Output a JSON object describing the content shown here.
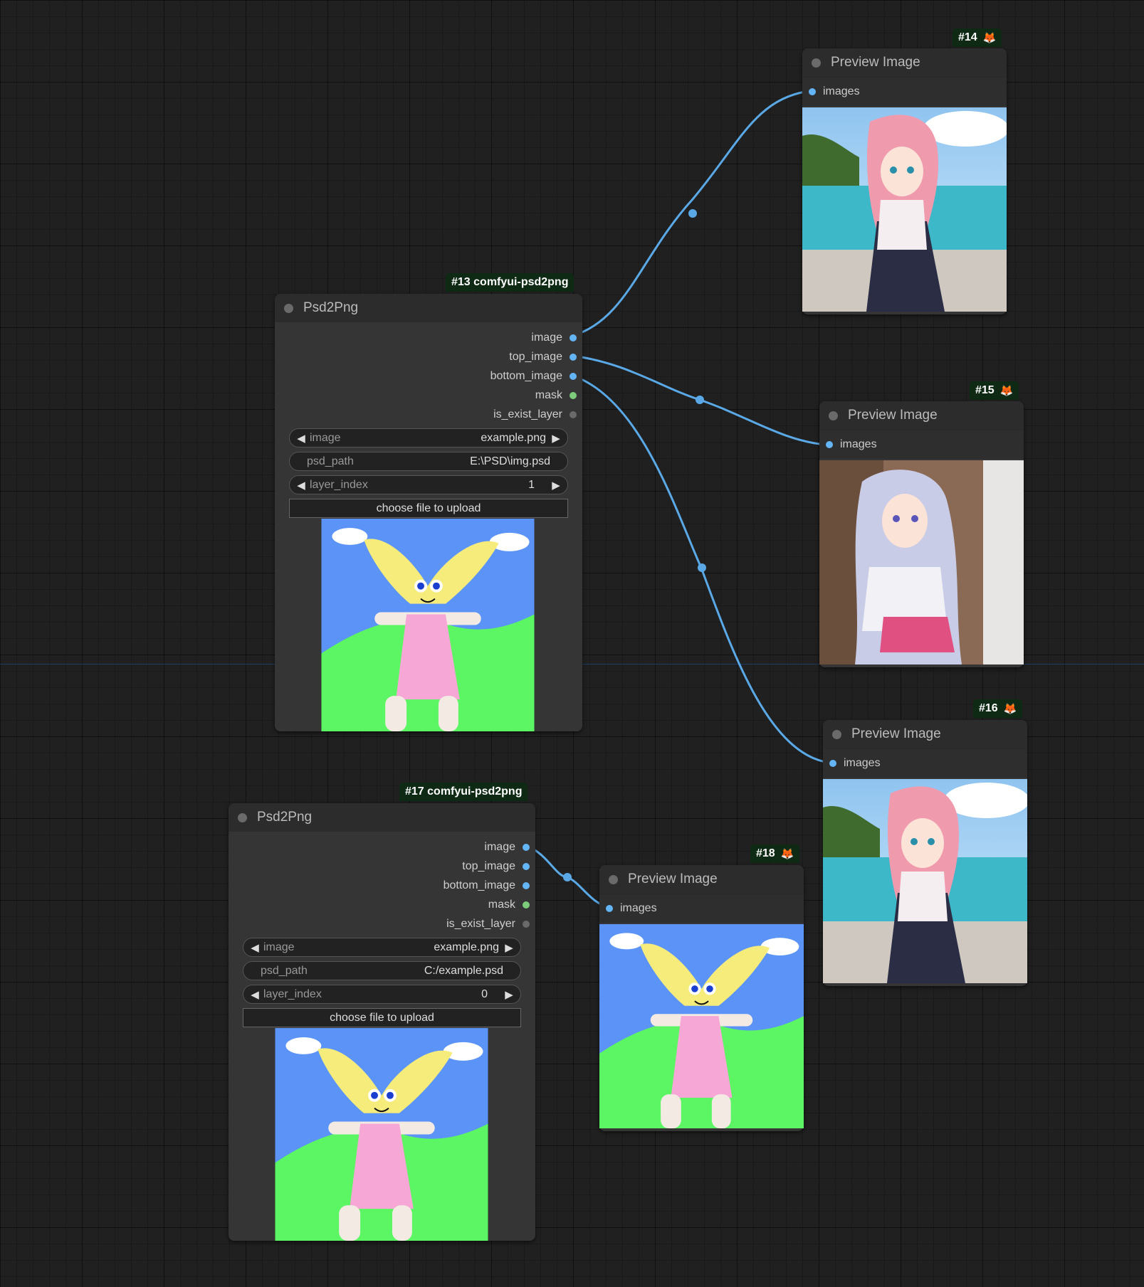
{
  "nodes": {
    "psd13": {
      "badge": "#13 comfyui-psd2png",
      "title": "Psd2Png",
      "outputs": [
        "image",
        "top_image",
        "bottom_image",
        "mask",
        "is_exist_layer"
      ],
      "image_label": "image",
      "image_value": "example.png",
      "psd_label": "psd_path",
      "psd_value": "E:\\PSD\\img.psd",
      "layer_label": "layer_index",
      "layer_value": "1",
      "upload_label": "choose file to upload"
    },
    "psd17": {
      "badge": "#17 comfyui-psd2png",
      "title": "Psd2Png",
      "outputs": [
        "image",
        "top_image",
        "bottom_image",
        "mask",
        "is_exist_layer"
      ],
      "image_label": "image",
      "image_value": "example.png",
      "psd_label": "psd_path",
      "psd_value": "C:/example.psd",
      "layer_label": "layer_index",
      "layer_value": "0",
      "upload_label": "choose file to upload"
    },
    "prev14": {
      "badge": "#14",
      "title": "Preview Image",
      "input": "images"
    },
    "prev15": {
      "badge": "#15",
      "title": "Preview Image",
      "input": "images"
    },
    "prev16": {
      "badge": "#16",
      "title": "Preview Image",
      "input": "images"
    },
    "prev18": {
      "badge": "#18",
      "title": "Preview Image",
      "input": "images"
    }
  },
  "colors": {
    "wire": "#5aa9e6",
    "badge_bg": "#0f2a14",
    "canvas": "#202020",
    "sky": "#5b93f6",
    "grass": "#5cf564",
    "dress": "#f6a7d6",
    "hair": "#f5ec7c"
  },
  "icons": [
    "fox-icon",
    "status-dot",
    "arrow-left-icon",
    "arrow-right-icon"
  ]
}
